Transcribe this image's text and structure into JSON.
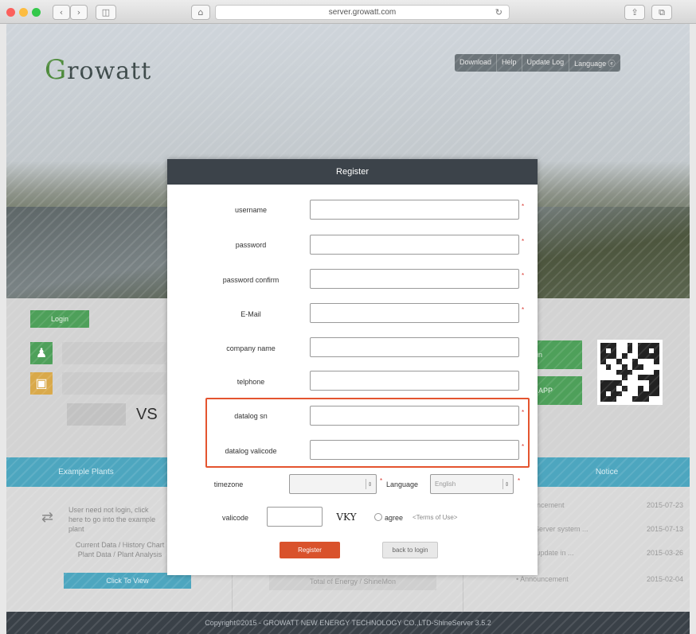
{
  "browser": {
    "url": "server.growatt.com",
    "back_glyph": "‹",
    "forward_glyph": "›",
    "sidebar_glyph": "◫",
    "home_glyph": "⌂",
    "reload_glyph": "↻",
    "share_glyph": "⇪",
    "tabs_glyph": "⧉"
  },
  "site": {
    "logo_g": "G",
    "logo_rest": "rowatt",
    "nav": [
      "Download",
      "Help",
      "Update Log",
      "Language ⓔ"
    ],
    "login_tab": "Login",
    "vs_text": "VS",
    "green_btn_1": "gin",
    "green_btn_2": "d APP",
    "band_left": "Example Plants",
    "band_right": "Notice",
    "example_text": "User need not login, click here to go into the example plant",
    "current_text": "Current Data / History Chart Plant Data / Plant Analysis",
    "click_to_view": "Click To View",
    "ghost_btn": "Total of Energy / ShineMon",
    "news": [
      {
        "title": "Announcement",
        "date": "2015-07-23"
      },
      {
        "title": "ShineServer system ...",
        "date": "2015-07-13"
      },
      {
        "title": "er will update in ...",
        "date": "2015-03-26"
      },
      {
        "title": "• Announcement",
        "date": "2015-02-04"
      }
    ],
    "footer": "Copyright©2015 - GROWATT NEW ENERGY TECHNOLOGY CO.,LTD-ShineServer 3.5.2"
  },
  "modal": {
    "title": "Register",
    "fields": [
      {
        "label": "username",
        "value": "",
        "required": true
      },
      {
        "label": "password",
        "value": "",
        "required": true
      },
      {
        "label": "password confirm",
        "value": "",
        "required": true
      },
      {
        "label": "E-Mail",
        "value": "",
        "required": true
      },
      {
        "label": "company name",
        "value": "",
        "required": false
      },
      {
        "label": "telphone",
        "value": "",
        "required": false
      },
      {
        "label": "datalog sn",
        "value": "",
        "required": true
      },
      {
        "label": "datalog valicode",
        "value": "",
        "required": true
      }
    ],
    "timezone_label": "timezone",
    "timezone_value": "",
    "language_label": "Language",
    "language_value": "English",
    "valicode_label": "valicode",
    "valicode_value": "",
    "captcha_text": "VKY",
    "agree_label": "agree",
    "terms_link": "<Terms of Use>",
    "register_button": "Register",
    "back_button": "back to login",
    "required_mark": "*",
    "select_arrow": "⇕",
    "highlight_color": "#e4542f"
  }
}
